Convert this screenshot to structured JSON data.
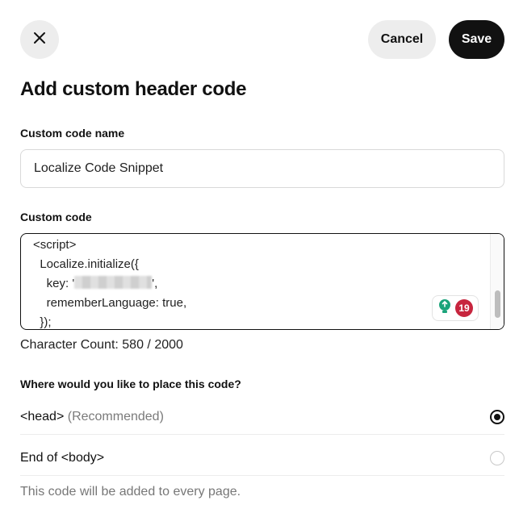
{
  "header": {
    "cancel_label": "Cancel",
    "save_label": "Save"
  },
  "title": "Add custom header code",
  "name_field": {
    "label": "Custom code name",
    "value": "Localize Code Snippet"
  },
  "code_field": {
    "label": "Custom code",
    "lines": {
      "l1": "<script>",
      "l2": "  Localize.initialize({",
      "l3_prefix": "    key: '",
      "l3_suffix": "',",
      "l4": "    rememberLanguage: true,",
      "l5": "  });"
    },
    "helper_badge_count": "19"
  },
  "char_count": "Character Count: 580 / 2000",
  "placement": {
    "question": "Where would you like to place this code?",
    "options": [
      {
        "label": "<head>",
        "hint": "(Recommended)",
        "selected": true
      },
      {
        "label": "End of <body>",
        "hint": "",
        "selected": false
      }
    ],
    "note": "This code will be added to every page."
  },
  "colors": {
    "primary": "#111111",
    "secondary_button": "#ededed",
    "badge": "#c7253e",
    "helper_icon": "#1aa37a"
  }
}
